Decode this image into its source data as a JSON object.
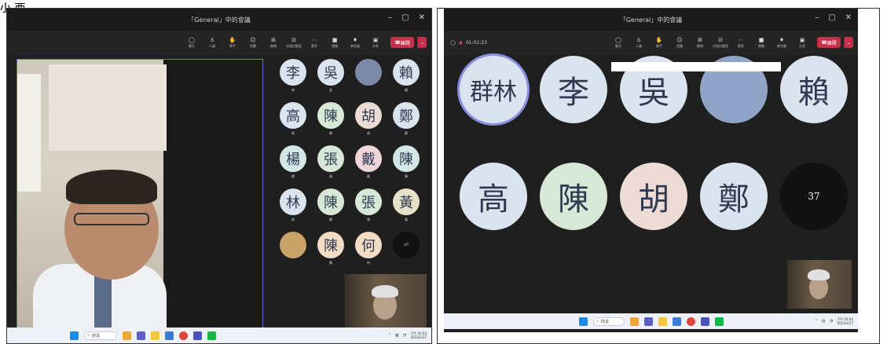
{
  "left": {
    "title": "「General」中的會議",
    "window_controls": [
      "–",
      "▢",
      "✕"
    ],
    "toolbar": [
      {
        "label": "聊天",
        "icon": "chat-icon",
        "glyph": "◯"
      },
      {
        "label": "人員",
        "icon": "people-icon",
        "glyph": "♙"
      },
      {
        "label": "舉手",
        "icon": "raise-hand-icon",
        "glyph": "✋"
      },
      {
        "label": "回應",
        "icon": "reactions-icon",
        "glyph": "☺"
      },
      {
        "label": "檢視",
        "icon": "view-icon",
        "glyph": "⊞"
      },
      {
        "label": "分組討論室",
        "icon": "breakout-icon",
        "glyph": "⊟"
      },
      {
        "label": "更多",
        "icon": "more-icon",
        "glyph": "⋯"
      },
      {
        "label": "相機",
        "icon": "camera-icon",
        "glyph": "■"
      },
      {
        "label": "麥克風",
        "icon": "mic-icon",
        "glyph": "♦"
      },
      {
        "label": "分享",
        "icon": "share-icon",
        "glyph": "▣"
      }
    ],
    "leave_label": "離開",
    "tiles": [
      {
        "char": "李",
        "name": "李",
        "color": "#d9e4ee"
      },
      {
        "char": "吳",
        "name": "吳",
        "color": "#d9e4ee"
      },
      {
        "char": "",
        "name": "",
        "color": "#7a8aa8",
        "photo": true
      },
      {
        "char": "賴",
        "name": "賴",
        "color": "#d9e4ee"
      },
      {
        "char": "高",
        "name": "高",
        "color": "#d9e4ee"
      },
      {
        "char": "陳",
        "name": "陳",
        "color": "#d8e8d6"
      },
      {
        "char": "胡",
        "name": "胡",
        "color": "#ecdcd5"
      },
      {
        "char": "鄭",
        "name": "鄭",
        "color": "#d9e4ee"
      },
      {
        "char": "楊",
        "name": "楊",
        "color": "#d3e8e6"
      },
      {
        "char": "張",
        "name": "張",
        "color": "#d8e8d6"
      },
      {
        "char": "戴",
        "name": "戴",
        "color": "#f0d6d9"
      },
      {
        "char": "陳",
        "name": "陳",
        "color": "#d3e8e6"
      },
      {
        "char": "林",
        "name": "林",
        "color": "#d9e4ee"
      },
      {
        "char": "陳",
        "name": "陳",
        "color": "#d8e8d6"
      },
      {
        "char": "張",
        "name": "張",
        "color": "#d8e8d6"
      },
      {
        "char": "黃",
        "name": "黃",
        "color": "#e6e2c8"
      },
      {
        "char": "",
        "name": "",
        "color": "#c9a46a",
        "photo": true
      },
      {
        "char": "陳",
        "name": "陳",
        "color": "#f3dcc4"
      },
      {
        "char": "何",
        "name": "何",
        "color": "#f3dcc4"
      },
      {
        "char": "37",
        "name": "",
        "color": "#111111",
        "count": true
      }
    ],
    "taskbar": {
      "search": "搜尋",
      "time": "下午 02:04",
      "date": "2023/3/27",
      "lang": "英"
    }
  },
  "right": {
    "title": "「General」中的會議",
    "timer": "01:02:23",
    "toolbar": [
      {
        "label": "聊天",
        "icon": "chat-icon",
        "glyph": "◯"
      },
      {
        "label": "人員",
        "icon": "people-icon",
        "glyph": "♙"
      },
      {
        "label": "舉手",
        "icon": "raise-hand-icon",
        "glyph": "✋"
      },
      {
        "label": "回應",
        "icon": "reactions-icon",
        "glyph": "☺"
      },
      {
        "label": "檢視",
        "icon": "view-icon",
        "glyph": "⊞"
      },
      {
        "label": "分組討論室",
        "icon": "breakout-icon",
        "glyph": "⊟"
      },
      {
        "label": "更多",
        "icon": "more-icon",
        "glyph": "⋯"
      },
      {
        "label": "相機",
        "icon": "camera-icon",
        "glyph": "■"
      },
      {
        "label": "麥克風",
        "icon": "mic-icon",
        "glyph": "♦"
      },
      {
        "label": "分享",
        "icon": "share-icon",
        "glyph": "▣"
      }
    ],
    "leave_label": "離開",
    "tiles": [
      {
        "char": "群林",
        "name": "",
        "color": "#d9e4ee",
        "ring": true
      },
      {
        "char": "李",
        "name": "",
        "color": "#d9e4ee"
      },
      {
        "char": "吳",
        "name": "",
        "color": "#d9e4ee"
      },
      {
        "char": "",
        "name": "",
        "color": "#8fa4c6",
        "photo": true
      },
      {
        "char": "賴",
        "name": "",
        "color": "#d9e4ee"
      },
      {
        "char": "高",
        "name": "",
        "color": "#d9e4ee"
      },
      {
        "char": "陳",
        "name": "",
        "color": "#d8e8d6"
      },
      {
        "char": "胡",
        "name": "",
        "color": "#ecdcd5"
      },
      {
        "char": "鄭",
        "name": "",
        "color": "#d9e4ee"
      },
      {
        "char": "37",
        "name": "",
        "color": "#111111",
        "count": true
      }
    ],
    "taskbar": {
      "search": "搜尋",
      "time": "下午 02:04",
      "date": "2023/3/27",
      "lang": "中"
    }
  },
  "top_mark": "小 西"
}
